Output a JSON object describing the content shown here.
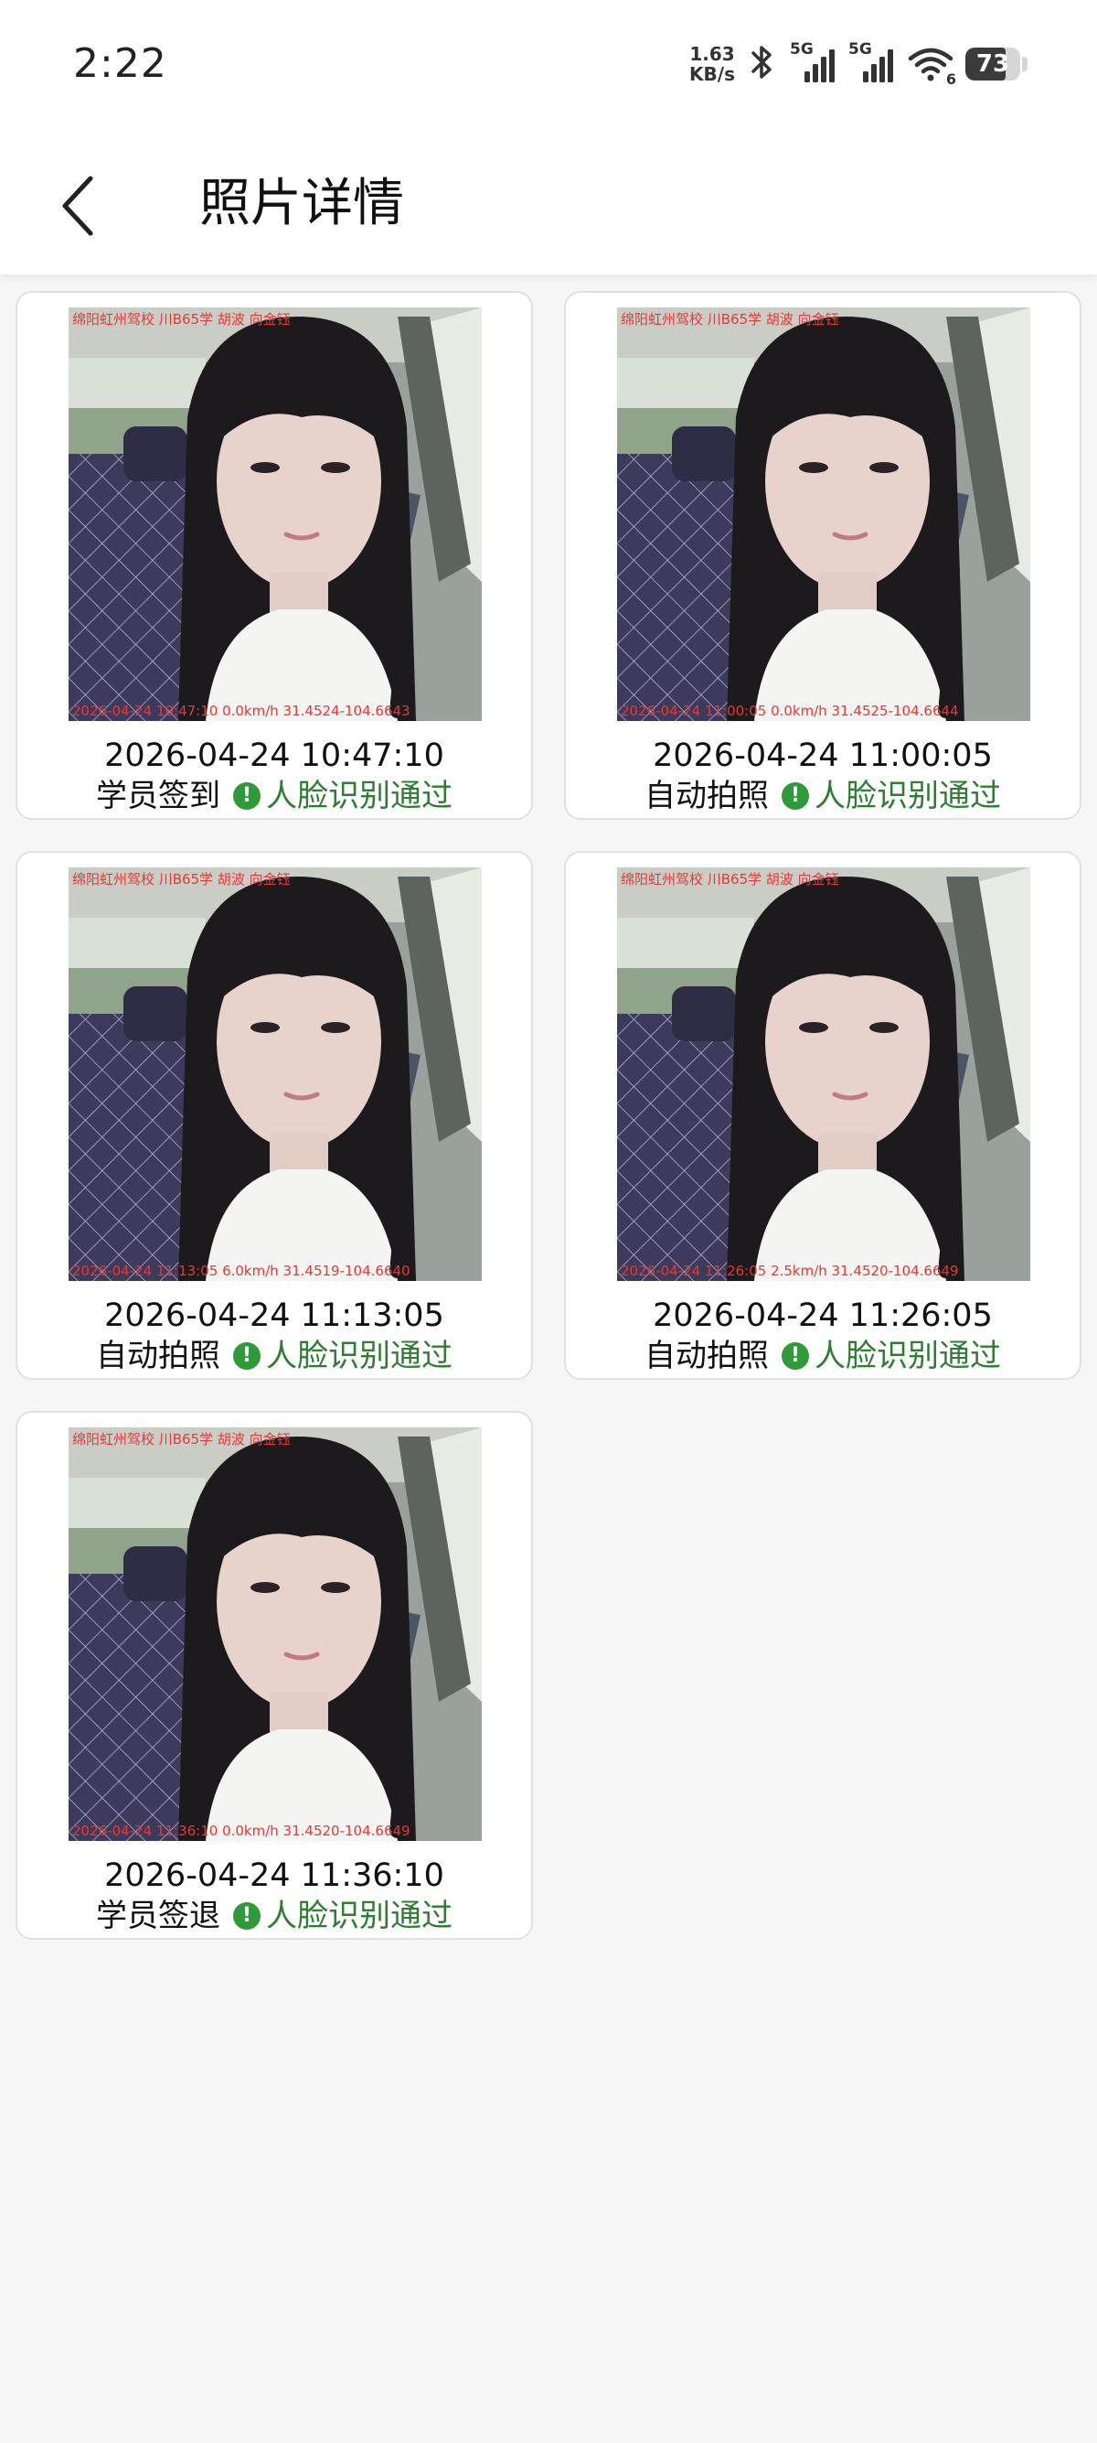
{
  "status_bar": {
    "time": "2:22",
    "net_speed_value": "1.63",
    "net_speed_unit": "KB/s",
    "sim1_label": "5G",
    "sim2_label": "5G",
    "wifi_label": "6",
    "battery_percent": "73",
    "icons": [
      "bluetooth-icon",
      "signal-icon",
      "signal-icon",
      "wifi-icon",
      "battery-icon"
    ]
  },
  "header": {
    "back_icon": "chevron-left-icon",
    "title": "照片详情"
  },
  "photos": [
    {
      "watermark_top": "绵阳虹州驾校 川B65学 胡波 向金钰",
      "watermark_bottom": "2026-04-24 10:47:10 0.0km/h 31.4524-104.6643",
      "time": "2026-04-24 10:47:10",
      "type": "学员签到",
      "result": "人脸识别通过"
    },
    {
      "watermark_top": "绵阳虹州驾校 川B65学 胡波 向金钰",
      "watermark_bottom": "2026-04-24 11:00:05 0.0km/h 31.4525-104.6644",
      "time": "2026-04-24 11:00:05",
      "type": "自动拍照",
      "result": "人脸识别通过"
    },
    {
      "watermark_top": "绵阳虹州驾校 川B65学 胡波 向金钰",
      "watermark_bottom": "2026-04-24 11:13:05 6.0km/h 31.4519-104.6640",
      "time": "2026-04-24 11:13:05",
      "type": "自动拍照",
      "result": "人脸识别通过"
    },
    {
      "watermark_top": "绵阳虹州驾校 川B65学 胡波 向金钰",
      "watermark_bottom": "2026-04-24 11:26:05 2.5km/h 31.4520-104.6649",
      "time": "2026-04-24 11:26:05",
      "type": "自动拍照",
      "result": "人脸识别通过"
    },
    {
      "watermark_top": "绵阳虹州驾校 川B65学 胡波 向金钰",
      "watermark_bottom": "2026-04-24 11:36:10 0.0km/h 31.4520-104.6649",
      "time": "2026-04-24 11:36:10",
      "type": "学员签退",
      "result": "人脸识别通过"
    }
  ],
  "colors": {
    "pass_green": "#2e7d32",
    "watermark_red": "#e53935",
    "page_background": "#f6f6f6"
  }
}
